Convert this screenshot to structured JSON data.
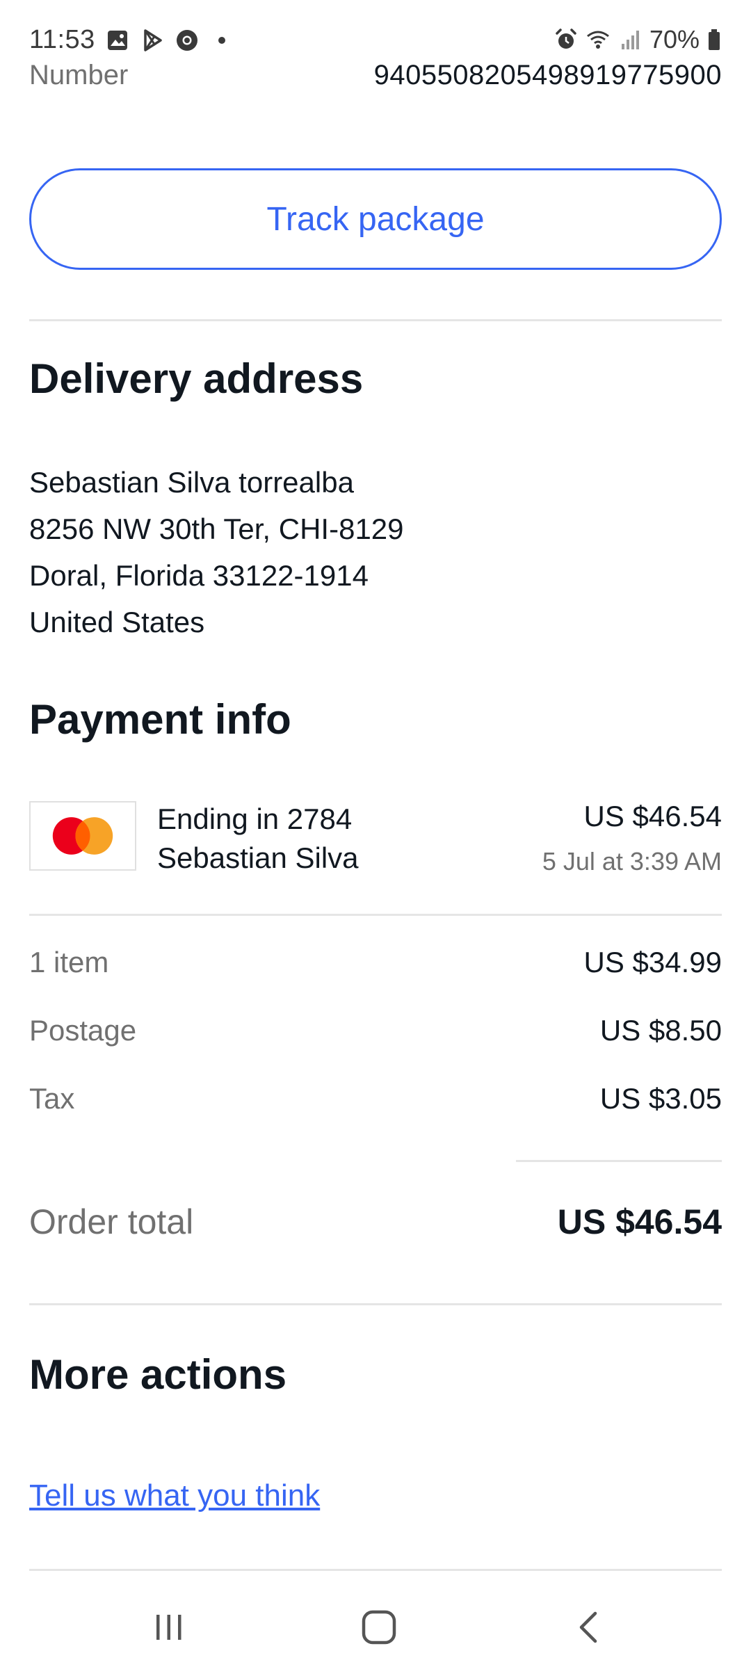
{
  "status_bar": {
    "time": "11:53",
    "battery": "70%",
    "icons": [
      "gallery-icon",
      "play-store-icon",
      "chrome-icon",
      "dot-icon",
      "alarm-icon",
      "wifi-icon",
      "signal-icon",
      "battery-icon"
    ]
  },
  "tracking": {
    "label": "Number",
    "value": "9405508205498919775900"
  },
  "track_button": {
    "label": "Track package"
  },
  "delivery": {
    "title": "Delivery address",
    "lines": [
      "Sebastian Silva torrealba",
      "8256 NW 30th Ter, CHI-8129",
      "Doral, Florida 33122-1914",
      "United States"
    ]
  },
  "payment": {
    "title": "Payment info",
    "card_icon": "mastercard-icon",
    "card_ending": "Ending in 2784",
    "card_holder": "Sebastian Silva",
    "amount": "US $46.54",
    "date": "5 Jul at 3:39 AM"
  },
  "summary": {
    "rows": [
      {
        "label": "1 item",
        "value": "US $34.99"
      },
      {
        "label": "Postage",
        "value": "US $8.50"
      },
      {
        "label": "Tax",
        "value": "US $3.05"
      }
    ],
    "total_label": "Order total",
    "total_value": "US $46.54"
  },
  "more_actions": {
    "title": "More actions",
    "feedback_link": "Tell us what you think"
  },
  "nav_bar": {
    "icons": [
      "recent-apps-icon",
      "home-icon",
      "back-icon"
    ]
  },
  "colors": {
    "accent": "#3665f3",
    "text": "#111820",
    "muted": "#707070",
    "divider": "#e5e5e5",
    "mastercard_red": "#eb001b",
    "mastercard_orange": "#f79e1b"
  }
}
